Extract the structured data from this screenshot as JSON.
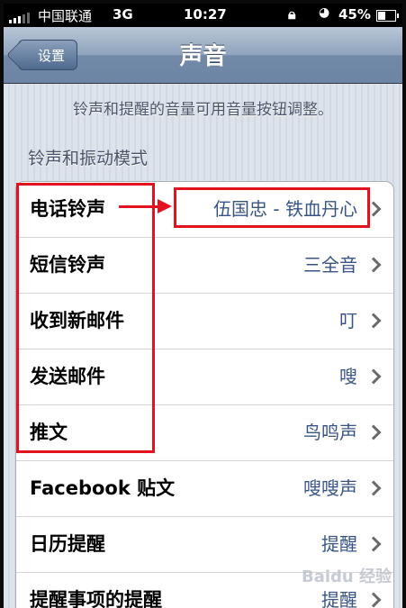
{
  "status_bar": {
    "carrier": "中国联通",
    "network": "3G",
    "time": "10:27",
    "battery": "45%"
  },
  "nav": {
    "back_label": "设置",
    "title": "声音"
  },
  "hint": "铃声和提醒的音量可用音量按钮调整。",
  "section_header": "铃声和振动模式",
  "rows": [
    {
      "label": "电话铃声",
      "value": "伍国忠 - 铁血丹心"
    },
    {
      "label": "短信铃声",
      "value": "三全音"
    },
    {
      "label": "收到新邮件",
      "value": "叮"
    },
    {
      "label": "发送邮件",
      "value": "嗖"
    },
    {
      "label": "推文",
      "value": "鸟鸣声"
    },
    {
      "label": "Facebook 贴文",
      "value": "嗖嗖声"
    },
    {
      "label": "日历提醒",
      "value": "提醒"
    },
    {
      "label": "提醒事项的提醒",
      "value": "提醒"
    }
  ],
  "watermark": "Baidu 经验",
  "colors": {
    "annotation": "#e2131e",
    "value_text": "#385487",
    "nav_bar": "#7289a8"
  }
}
